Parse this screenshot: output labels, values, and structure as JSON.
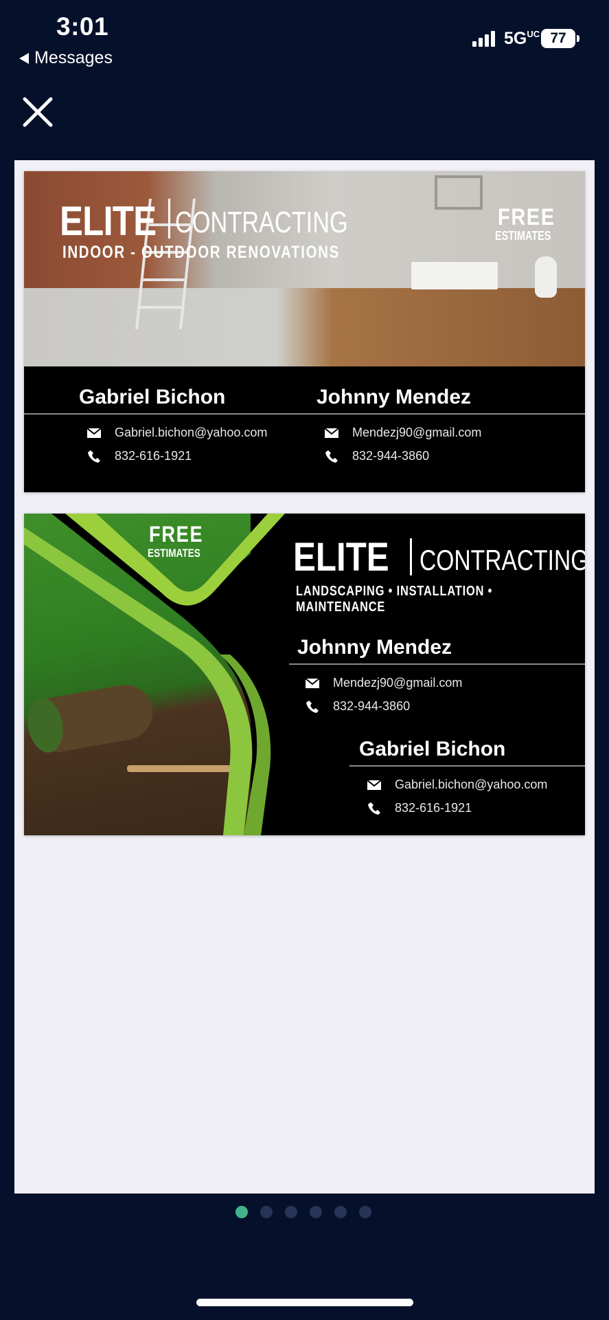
{
  "status_bar": {
    "time": "3:01",
    "back_label": "Messages",
    "network": "5G",
    "network_suffix": "UC",
    "battery": "77"
  },
  "viewer": {
    "close_icon": "close-icon",
    "pages": 6,
    "active_page": 1
  },
  "card1": {
    "brand": "ELITE",
    "brand_sub": "CONTRACTING",
    "tagline": "INDOOR - OUTDOOR RENOVATIONS",
    "free": "FREE",
    "estimates": "ESTIMATES",
    "person_a": {
      "name": "Gabriel Bichon",
      "email": "Gabriel.bichon@yahoo.com",
      "phone": "832-616-1921"
    },
    "person_b": {
      "name": "Johnny Mendez",
      "email": "Mendezj90@gmail.com",
      "phone": "832-944-3860"
    }
  },
  "card2": {
    "free": "FREE",
    "estimates": "ESTIMATES",
    "brand": "ELITE",
    "brand_sub": "CONTRACTING",
    "tagline": "LANDSCAPING • INSTALLATION • MAINTENANCE",
    "person_a": {
      "name": "Johnny Mendez",
      "email": "Mendezj90@gmail.com",
      "phone": "832-944-3860"
    },
    "person_b": {
      "name": "Gabriel Bichon",
      "email": "Gabriel.bichon@yahoo.com",
      "phone": "832-616-1921"
    }
  },
  "colors": {
    "background": "#05102b",
    "active_dot": "#43b38a",
    "inactive_dot": "#263457",
    "accent_green": "#9ccf3c"
  }
}
